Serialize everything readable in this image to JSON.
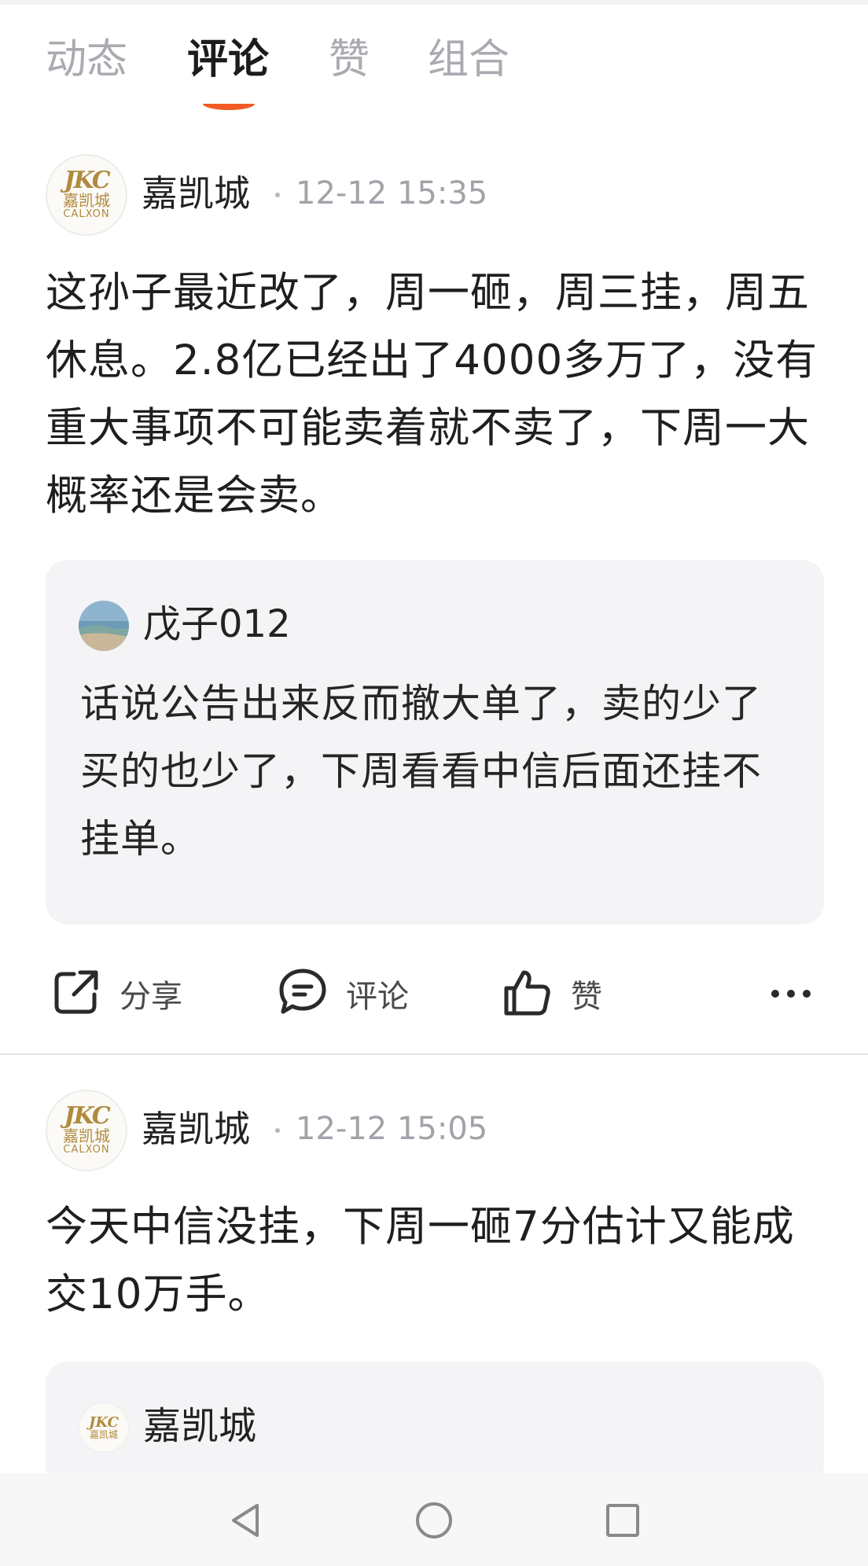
{
  "tabs": [
    {
      "label": "动态",
      "active": false
    },
    {
      "label": "评论",
      "active": true
    },
    {
      "label": "赞",
      "active": false
    },
    {
      "label": "组合",
      "active": false
    }
  ],
  "accent_color": "#f25a24",
  "avatar_logo": {
    "mark": "JKC",
    "cn": "嘉凯城",
    "en": "CALXON"
  },
  "posts": [
    {
      "author": "嘉凯城",
      "time": "12-12 15:35",
      "content": "这孙子最近改了，周一砸，周三挂，周五休息。2.8亿已经出了4000多万了，没有重大事项不可能卖着就不卖了，下周一大概率还是会卖。",
      "quote": {
        "author": "戊子012",
        "text": "话说公告出来反而撤大单了，卖的少了买的也少了，下周看看中信后面还挂不挂单。"
      }
    },
    {
      "author": "嘉凯城",
      "time": "12-12 15:05",
      "content": "今天中信没挂，下周一砸7分估计又能成交10万手。",
      "quote": {
        "author": "嘉凯城"
      }
    }
  ],
  "actions": {
    "share": "分享",
    "comment": "评论",
    "like": "赞"
  }
}
